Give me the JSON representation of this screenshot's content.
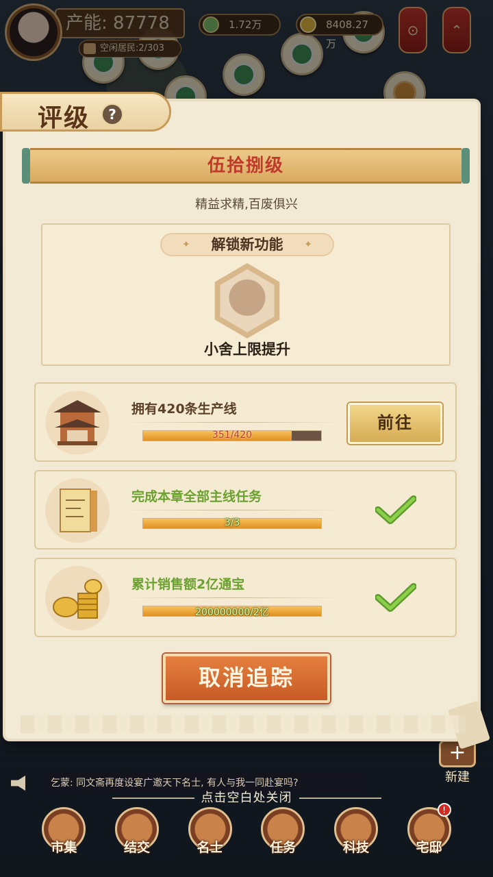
{
  "topbar": {
    "production_label": "产能:",
    "production_value": "87778",
    "idle_residents": "空闲居民:2/303",
    "currency_jade": "1.72万",
    "currency_gold": "8408.27万"
  },
  "dialog": {
    "tab_title": "评级",
    "help_glyph": "?",
    "level_name": "伍拾捌级",
    "level_motto": "精益求精,百废俱兴",
    "unlock_header": "解锁新功能",
    "unlock_feature": "小舍上限提升",
    "tasks": [
      {
        "label": "拥有420条生产线",
        "progress_text": "351/420",
        "progress": 0.836,
        "action": "前往",
        "done": false
      },
      {
        "label": "完成本章全部主线任务",
        "progress_text": "3/3",
        "progress": 1.0,
        "done": true
      },
      {
        "label": "累计销售额2亿通宝",
        "progress_text": "200000000/2亿",
        "progress": 1.0,
        "done": true
      }
    ],
    "cancel_button": "取消追踪"
  },
  "background": {
    "new_build_label": "新建",
    "chat_message": "乞蒙: 同文斋再度设宴广邀天下名士, 有人与我一同赴宴吗?",
    "close_hint": "点击空白处关闭"
  },
  "nav": {
    "items": [
      {
        "label": "市集",
        "icon": "market-icon"
      },
      {
        "label": "结交",
        "icon": "friends-icon"
      },
      {
        "label": "名士",
        "icon": "scholar-icon"
      },
      {
        "label": "任务",
        "icon": "task-icon"
      },
      {
        "label": "科技",
        "icon": "tech-icon"
      },
      {
        "label": "宅邸",
        "icon": "mansion-icon",
        "badge": "!"
      }
    ]
  },
  "colors": {
    "accent": "#c0392b",
    "done_green": "#6aa12f",
    "progress_orange": "#e09022"
  }
}
